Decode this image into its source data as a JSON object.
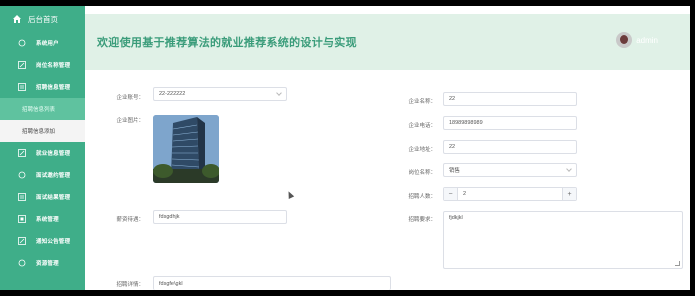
{
  "sidebar": {
    "home_label": "后台首页",
    "items": [
      {
        "label": "系统用户"
      },
      {
        "label": "岗位名称管理"
      },
      {
        "label": "招聘信息管理"
      },
      {
        "label": "招聘信息列表",
        "sub": true,
        "active": true
      },
      {
        "label": "招聘信息添加",
        "sub": true,
        "active": false
      },
      {
        "label": "就业信息管理"
      },
      {
        "label": "面试邀约管理"
      },
      {
        "label": "面试结果管理"
      },
      {
        "label": "系统管理"
      },
      {
        "label": "通知公告管理"
      },
      {
        "label": "资源管理"
      }
    ]
  },
  "header": {
    "title": "欢迎使用基于推荐算法的就业推荐系统的设计与实现",
    "username": "admin"
  },
  "form": {
    "company_account_label": "企业账号：",
    "company_account_value": "22-222222",
    "company_image_label": "企业图片：",
    "salary_label": "薪资待遇：",
    "salary_value": "fdsgdhjk",
    "details_label": "招聘详情：",
    "details_value": "fdsgfe\\gkl",
    "company_name_label": "企业名称：",
    "company_name_value": "22",
    "company_phone_label": "企业电话：",
    "company_phone_value": "18989898989",
    "company_address_label": "企业地址：",
    "company_address_value": "22",
    "position_label": "岗位名称：",
    "position_value": "销售",
    "headcount_label": "招聘人数：",
    "headcount_value": "2",
    "minus": "−",
    "plus": "+",
    "requirements_label": "招聘要求：",
    "requirements_value": "fjdkjkl"
  },
  "colors": {
    "sidebar": "#3fae89",
    "header_bg": "#e0f1e7",
    "title": "#3a9c7a",
    "active_sub": "#5fc29f"
  }
}
